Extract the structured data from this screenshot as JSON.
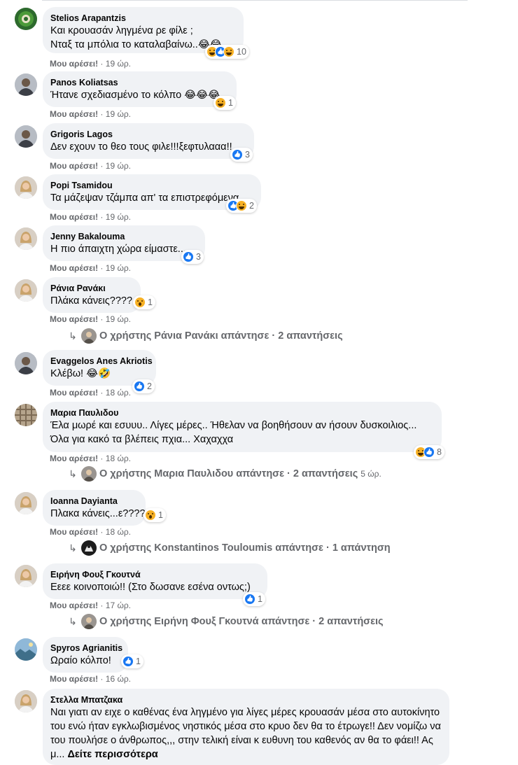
{
  "like_label": "Μου αρέσει!",
  "colors": {
    "bubble": "#f0f2f5",
    "meta": "#65676b",
    "like_blue": "#1877f2",
    "emoji_yellow": "#f7b125"
  },
  "comments": [
    {
      "author": "Stelios Arapantzis",
      "lines": [
        "Και κρουασάν ληγμένα ρε φίλε ;",
        "Νταξ τα μπόλια το καταλαβαίνω..😂😂"
      ],
      "time": "19 ώρ.",
      "reactions": [
        "haha",
        "like",
        "haha"
      ],
      "reaction_count": "10",
      "avatar": "green-avatar"
    },
    {
      "author": "Panos Koliatsas",
      "lines": [
        "Ήτανε σχεδιασμένο το κόλπο 😂😂😂"
      ],
      "time": "19 ώρ.",
      "reactions": [
        "haha"
      ],
      "reaction_count": "1",
      "avatar": "man-avatar"
    },
    {
      "author": "Grigoris Lagos",
      "lines": [
        "Δεν εχουν το θεο τους φιλε!!!ξεφτυλααα!!"
      ],
      "time": "19 ώρ.",
      "reactions": [
        "like"
      ],
      "reaction_count": "3",
      "avatar": "man-avatar"
    },
    {
      "author": "Popi Tsamidou",
      "lines": [
        "Τα μάζεψαν τζάμπα απ' τα επιστρεφόμενα"
      ],
      "time": "19 ώρ.",
      "reactions": [
        "like",
        "haha"
      ],
      "reaction_count": "2",
      "avatar": "woman-avatar"
    },
    {
      "author": "Jenny Bakalouma",
      "lines": [
        "Η πιο άπαιχτη χώρα είμαστε....."
      ],
      "time": "19 ώρ.",
      "reactions": [
        "like"
      ],
      "reaction_count": "3",
      "avatar": "woman-avatar"
    },
    {
      "author": "Ράνια Ρανάκι",
      "lines": [
        "Πλάκα κάνεις????"
      ],
      "time": "19 ώρ.",
      "reactions": [
        "wow"
      ],
      "reaction_count": "1",
      "avatar": "woman-avatar",
      "reply": {
        "text": "Ο χρήστης Ράνια Ρανάκι απάντησε · 2 απαντήσεις",
        "time": ""
      }
    },
    {
      "author": "Evaggelos Anes Akriotis",
      "lines": [
        "Κλέβω! 😂🤣"
      ],
      "time": "18 ώρ.",
      "reactions": [
        "like"
      ],
      "reaction_count": "2",
      "avatar": "man-avatar"
    },
    {
      "author": "Μαρια Παυλιδου",
      "lines": [
        "Έλα μωρέ και εσυυυ.. Λίγες μέρες.. Ήθελαν να βοηθήσουν αν ήσουν δυσκοιλιος...",
        "Όλα για κακό τα βλέπεις πχια... Χαχαχχα"
      ],
      "time": "18 ώρ.",
      "reactions": [
        "haha",
        "like"
      ],
      "reaction_count": "8",
      "avatar": "pattern-avatar",
      "reply": {
        "text": "Ο χρήστης Μαρια Παυλιδου απάντησε · 2 απαντήσεις",
        "time": "5 ώρ."
      }
    },
    {
      "author": "Ioanna Dayianta",
      "lines": [
        "Πλακα κάνεις...ε????"
      ],
      "time": "18 ώρ.",
      "reactions": [
        "wow"
      ],
      "reaction_count": "1",
      "avatar": "woman-avatar",
      "reply": {
        "text": "Ο χρήστης Konstantinos Touloumis απάντησε · 1 απάντηση",
        "time": ""
      }
    },
    {
      "author": "Ειρήνη Φουξ Γκουτνά",
      "lines": [
        "Εεεε κοινοποιώ!! (Στο δωσανε εσένα οντως;)"
      ],
      "time": "17 ώρ.",
      "reactions": [
        "like"
      ],
      "reaction_count": "1",
      "avatar": "woman-avatar",
      "reply": {
        "text": "Ο χρήστης Ειρήνη Φουξ Γκουτνά απάντησε · 2 απαντήσεις",
        "time": ""
      }
    },
    {
      "author": "Spyros Agrianitis",
      "lines": [
        "Ωραίο κόλπο!"
      ],
      "time": "16 ώρ.",
      "reactions": [
        "like"
      ],
      "reaction_count": "1",
      "avatar": "landscape-avatar"
    },
    {
      "author": "Στελλα Μπατζακα",
      "lines": [
        "Ναι γιατι αν ειχε ο καθένας ένα ληγμένο για λίγες μέρες κρουασάν μέσα στο αυτοκίνητο του ενώ ήταν εγκλωβισμένος νηστικός μέσα στο κρυο δεν θα το έτρωγε!! Δεν νομίζω να του πουλήσε ο άνθρωπος,,, στην τελική είναι κ ευθυνη του καθενός αν θα το φάει!! Ας μ..."
      ],
      "more": "Δείτε περισσότερα",
      "avatar": "woman-avatar"
    }
  ]
}
